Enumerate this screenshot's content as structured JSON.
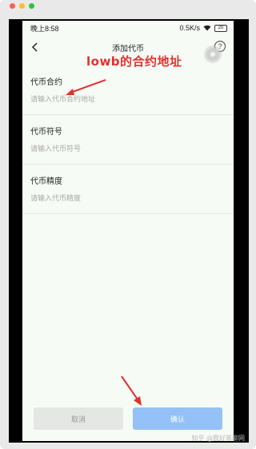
{
  "status_bar": {
    "time": "晚上8:58",
    "network_speed": "0.5K/s",
    "battery": "20"
  },
  "nav": {
    "title": "添加代币",
    "help_glyph": "?"
  },
  "form": {
    "fields": [
      {
        "label": "代币合约",
        "placeholder": "请输入代币合约地址"
      },
      {
        "label": "代币符号",
        "placeholder": "请输入代币符号"
      },
      {
        "label": "代币精度",
        "placeholder": "请输入代币精度"
      }
    ]
  },
  "annotation": {
    "text": "lowb的合约地址",
    "color": "#e0312b"
  },
  "buttons": {
    "cancel": "取消",
    "confirm": "确认"
  },
  "watermark": "知乎 @我好笨聊网",
  "colors": {
    "confirm_bg": "#93c1f8",
    "cancel_bg": "#e4e7e3",
    "screen_bg": "#f7fbf6"
  }
}
